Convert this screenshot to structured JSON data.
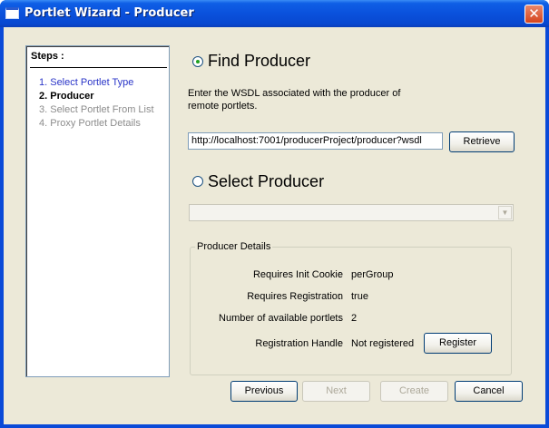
{
  "window": {
    "title": "Portlet Wizard - Producer",
    "close_glyph": "✕"
  },
  "steps": {
    "title": "Steps :",
    "items": [
      {
        "label": "1. Select Portlet Type",
        "state": "done"
      },
      {
        "label": "2. Producer",
        "state": "current"
      },
      {
        "label": "3. Select Portlet From List",
        "state": "future"
      },
      {
        "label": "4. Proxy Portlet Details",
        "state": "future"
      }
    ]
  },
  "find": {
    "label": "Find Producer",
    "selected": true,
    "description": "Enter the WSDL associated with the producer of remote portlets.",
    "wsdl_value": "http://localhost:7001/producerProject/producer?wsdl",
    "retrieve_label": "Retrieve"
  },
  "select": {
    "label": "Select Producer",
    "selected": false,
    "combo_value": ""
  },
  "details": {
    "legend": "Producer Details",
    "rows": [
      {
        "label": "Requires Init Cookie",
        "value": "perGroup"
      },
      {
        "label": "Requires Registration",
        "value": "true"
      },
      {
        "label": "Number of available portlets",
        "value": "2"
      },
      {
        "label": "Registration Handle",
        "value": "Not registered"
      }
    ],
    "colon": ":",
    "register_label": "Register"
  },
  "footer": {
    "previous": "Previous",
    "next": "Next",
    "create": "Create",
    "cancel": "Cancel"
  },
  "colors": {
    "titlebar": "#0a51dc",
    "dialog_bg": "#ece9d8",
    "step_done": "#2a35c8",
    "step_future": "#8c8c8c"
  }
}
